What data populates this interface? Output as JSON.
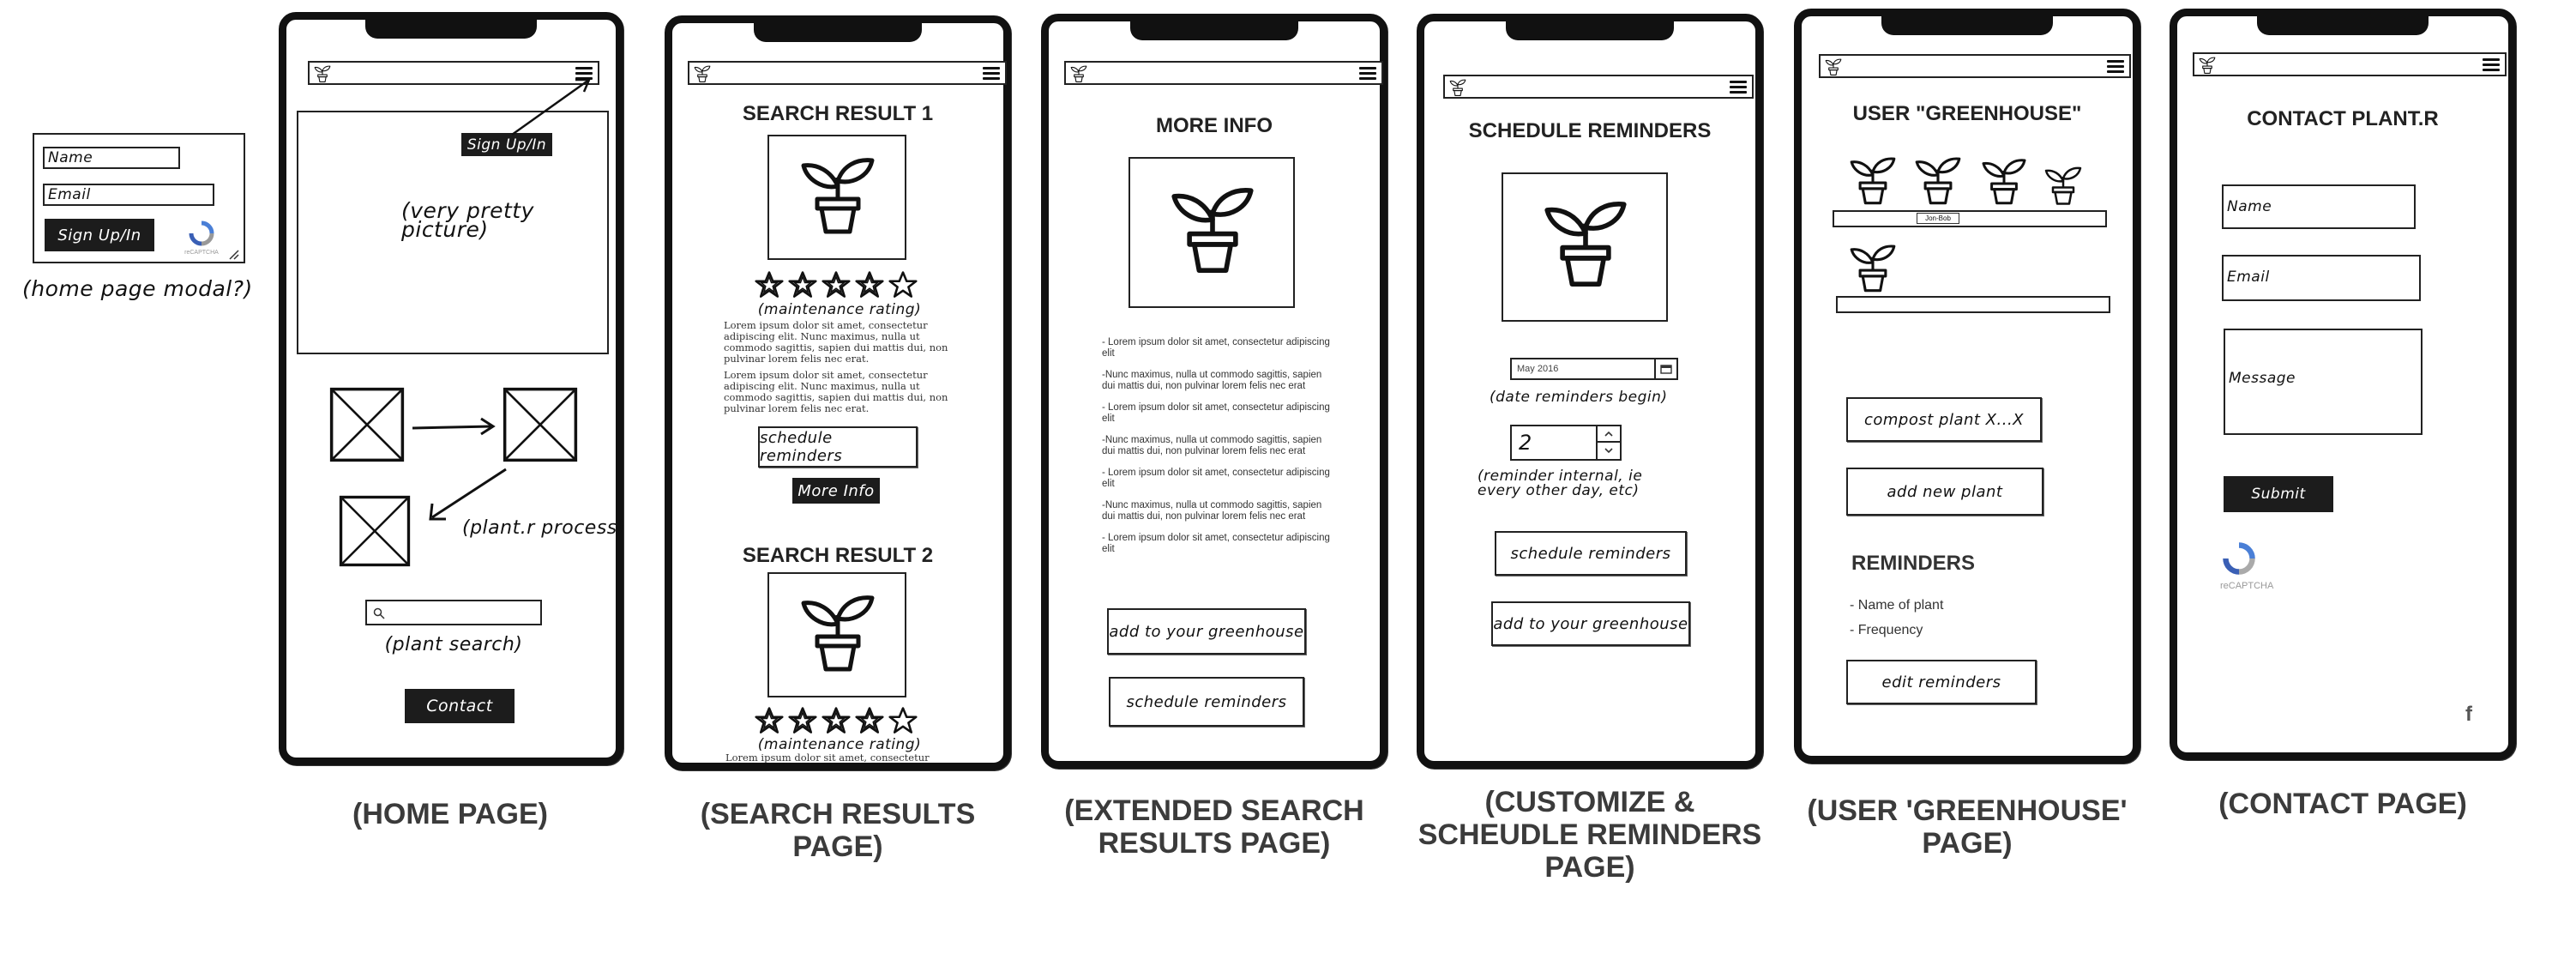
{
  "modal": {
    "name_placeholder": "Name",
    "email_placeholder": "Email",
    "button": "Sign Up/In",
    "captcha": "reCAPTCHA",
    "caption": "(home page modal?)"
  },
  "home": {
    "signup_button": "Sign Up/In",
    "hero_text": "(very pretty\npicture)",
    "process_label": "(plant.r process)",
    "search_label": "(plant search)",
    "contact_button": "Contact",
    "caption": "(HOME PAGE)"
  },
  "search": {
    "result1_title": "SEARCH RESULT 1",
    "rating_label": "(maintenance rating)",
    "rating_value": 4,
    "rating_max": 5,
    "para1": "Lorem ipsum dolor sit amet, consectetur adipiscing elit. Nunc maximus, nulla ut commodo sagittis, sapien dui mattis dui, non pulvinar lorem felis nec erat.",
    "para2": "Lorem ipsum dolor sit amet, consectetur adipiscing elit. Nunc maximus, nulla ut commodo sagittis, sapien dui mattis dui, non pulvinar lorem felis nec erat.",
    "schedule_button": "schedule reminders",
    "more_info_button": "More Info",
    "result2_title": "SEARCH RESULT 2",
    "rating2_label": "(maintenance rating)",
    "para3": "Lorem ipsum dolor sit amet, consectetur",
    "caption": "(SEARCH RESULTS\nPAGE)"
  },
  "more": {
    "title": "MORE INFO",
    "bullets": [
      "- Lorem ipsum dolor sit amet, consectetur adipiscing elit",
      "-Nunc maximus, nulla ut commodo sagittis, sapien dui mattis dui, non pulvinar lorem felis nec erat",
      "- Lorem ipsum dolor sit amet, consectetur adipiscing elit",
      "-Nunc maximus, nulla ut commodo sagittis, sapien dui mattis dui, non pulvinar lorem felis nec erat",
      "- Lorem ipsum dolor sit amet, consectetur adipiscing elit",
      "-Nunc maximus, nulla ut commodo sagittis, sapien dui mattis dui, non pulvinar lorem felis nec erat",
      "- Lorem ipsum dolor sit amet, consectetur adipiscing elit"
    ],
    "add_button": "add to your greenhouse",
    "schedule_button": "schedule reminders",
    "caption": "(EXTENDED SEARCH\nRESULTS PAGE)"
  },
  "schedule": {
    "title": "SCHEDULE REMINDERS",
    "date_value": "May 2016",
    "date_label": "(date reminders begin)",
    "interval_value": "2",
    "interval_label": "(reminder internal, ie\nevery other day, etc)",
    "schedule_button": "schedule reminders",
    "add_button": "add to your greenhouse",
    "caption": "(CUSTOMIZE &\nSCHEUDLE REMINDERS\nPAGE)"
  },
  "greenhouse": {
    "title": "USER \"GREENHOUSE\"",
    "shelf_tag": "Jon-Bob",
    "compost_button": "compost plant X...X",
    "add_button": "add new plant",
    "reminders_title": "REMINDERS",
    "reminders": [
      "- Name of plant",
      "- Frequency"
    ],
    "edit_button": "edit reminders",
    "caption": "(USER 'GREENHOUSE'\nPAGE)"
  },
  "contact": {
    "title": "CONTACT PLANT.R",
    "name_placeholder": "Name",
    "email_placeholder": "Email",
    "message_placeholder": "Message",
    "submit_button": "Submit",
    "captcha": "reCAPTCHA",
    "social_icon": "f",
    "caption": "(CONTACT PAGE)"
  }
}
